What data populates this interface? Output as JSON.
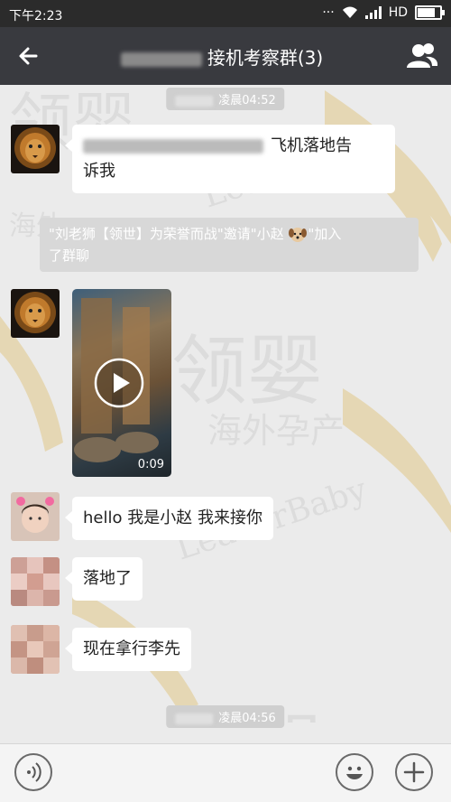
{
  "status_bar": {
    "time": "下午2:23",
    "network_label": "HD",
    "battery_level": 0.85
  },
  "header": {
    "title": "接机考察群(3)"
  },
  "timestamps": [
    "凌晨04:52",
    "凌晨04:56"
  ],
  "messages": {
    "m1": {
      "text_line1": "飞机落地告",
      "text_line2": "诉我"
    },
    "system": {
      "line1": "\"刘老狮【领世】为荣誉而战\"邀请\"小赵",
      "line2": "了群聊",
      "join": "\"加入"
    },
    "video": {
      "duration": "0:09"
    },
    "m3": {
      "text": "hello 我是小赵 我来接你"
    },
    "m4": {
      "text": "落地了"
    },
    "m5": {
      "text": "现在拿行李先"
    }
  },
  "colors": {
    "titlebar": "#393a3f",
    "statusbar": "#2b2b2b",
    "chat_bg": "#ebebeb",
    "watermark": "#d9a62a"
  }
}
